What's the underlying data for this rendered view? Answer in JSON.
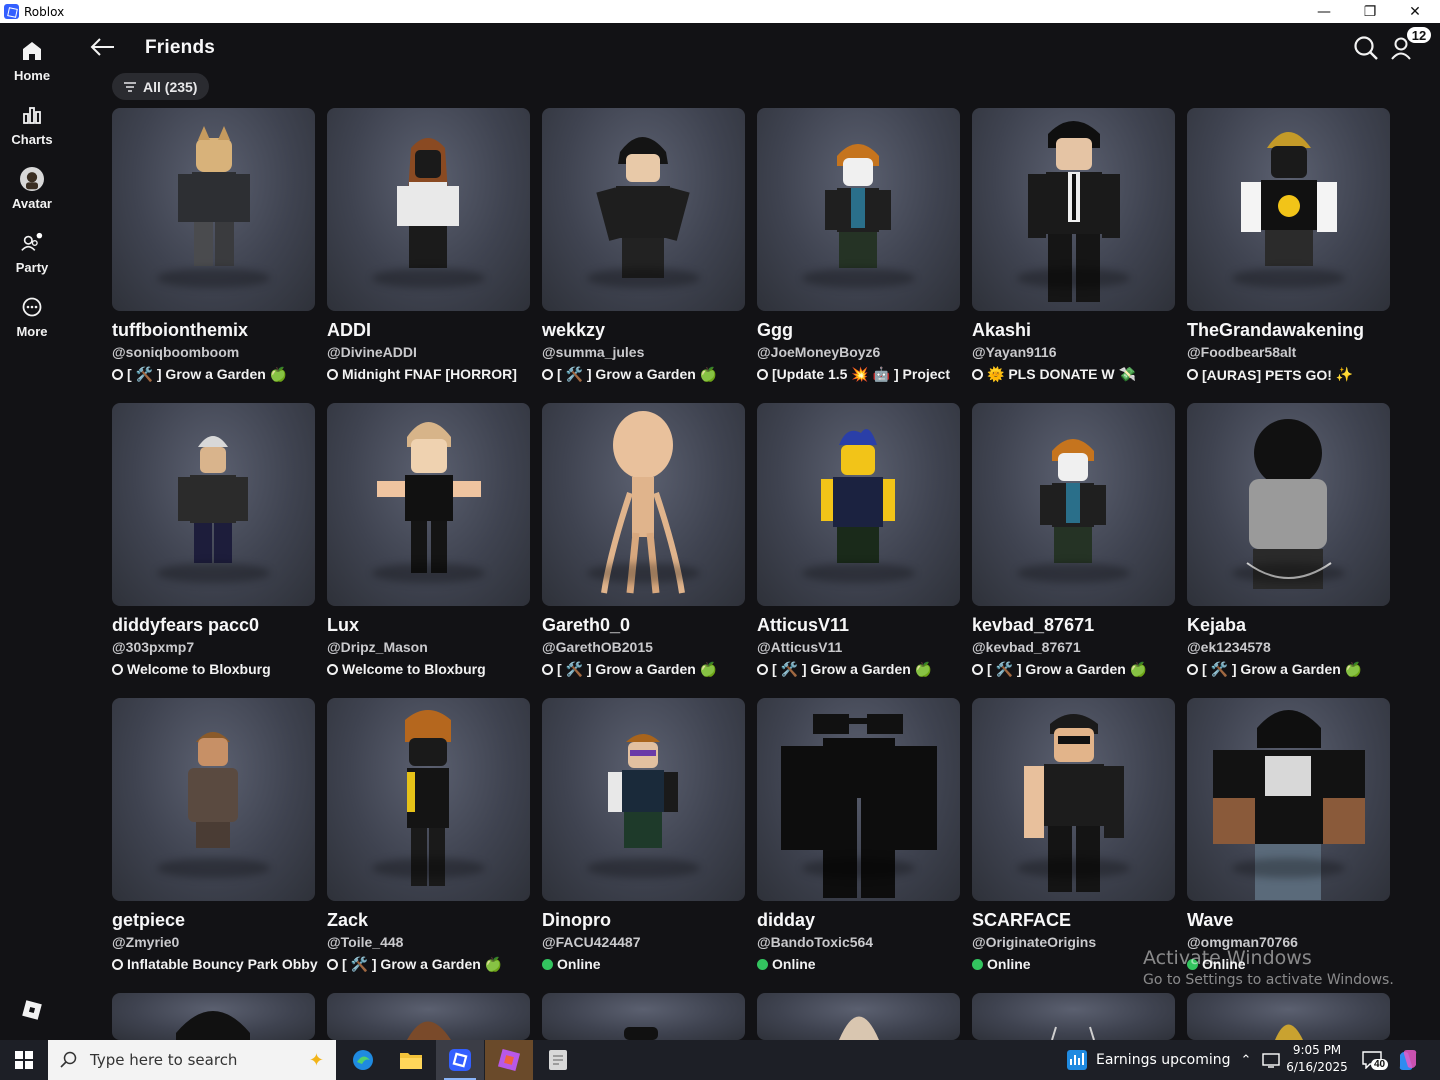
{
  "window": {
    "title": "Roblox",
    "minimize_glyph": "—",
    "restore_glyph": "❐",
    "close_glyph": "✕"
  },
  "sidebar": {
    "items": [
      {
        "label": "Home",
        "icon": "home-icon"
      },
      {
        "label": "Charts",
        "icon": "charts-icon"
      },
      {
        "label": "Avatar",
        "icon": "avatar-icon"
      },
      {
        "label": "Party",
        "icon": "party-icon"
      },
      {
        "label": "More",
        "icon": "more-icon"
      }
    ]
  },
  "header": {
    "title": "Friends",
    "notification_count": "12"
  },
  "filter": {
    "label": "All (235)"
  },
  "colors": {
    "background": "#121215",
    "online": "#33c45f",
    "brand": "#335fff"
  },
  "friends": [
    {
      "name": "tuffboionthemix",
      "username": "@soniqboomboom",
      "status": "[ 🛠️ ] Grow a Garden",
      "emoji": "🍏",
      "online": false
    },
    {
      "name": "ADDI",
      "username": "@DivineADDI",
      "status": "Midnight FNAF [HORROR]",
      "emoji": "",
      "online": false
    },
    {
      "name": "wekkzy",
      "username": "@summa_jules",
      "status": "[ 🛠️ ] Grow a Garden",
      "emoji": "🍏",
      "online": false
    },
    {
      "name": "Ggg",
      "username": "@JoeMoneyBoyz6",
      "status": "[Update 1.5 💥 🤖 ] Project",
      "emoji": "",
      "online": false
    },
    {
      "name": "Akashi",
      "username": "@Yayan9116",
      "status": "🌞 PLS DONATE W 💸",
      "emoji": "",
      "online": false
    },
    {
      "name": "TheGrandawakening",
      "username": "@Foodbear58alt",
      "status": "[AURAS] PETS GO!",
      "emoji": "✨",
      "online": false
    },
    {
      "name": "diddyfears pacc0",
      "username": "@303pxmp7",
      "status": "Welcome to Bloxburg",
      "emoji": "",
      "online": false
    },
    {
      "name": "Lux",
      "username": "@Dripz_Mason",
      "status": "Welcome to Bloxburg",
      "emoji": "",
      "online": false
    },
    {
      "name": "Gareth0_0",
      "username": "@GarethOB2015",
      "status": "[ 🛠️ ] Grow a Garden",
      "emoji": "🍏",
      "online": false
    },
    {
      "name": "AtticusV11",
      "username": "@AtticusV11",
      "status": "[ 🛠️ ] Grow a Garden",
      "emoji": "🍏",
      "online": false
    },
    {
      "name": "kevbad_87671",
      "username": "@kevbad_87671",
      "status": "[ 🛠️ ] Grow a Garden",
      "emoji": "🍏",
      "online": false
    },
    {
      "name": "Kejaba",
      "username": "@ek1234578",
      "status": "[ 🛠️ ] Grow a Garden",
      "emoji": "🍏",
      "online": false
    },
    {
      "name": "getpiece",
      "username": "@Zmyrie0",
      "status": "Inflatable Bouncy Park Obby",
      "emoji": "",
      "online": false
    },
    {
      "name": "Zack",
      "username": "@Toile_448",
      "status": "[ 🛠️ ] Grow a Garden",
      "emoji": "🍏",
      "online": false
    },
    {
      "name": "Dinopro",
      "username": "@FACU424487",
      "status": "Online",
      "emoji": "",
      "online": true
    },
    {
      "name": "didday",
      "username": "@BandoToxic564",
      "status": "Online",
      "emoji": "",
      "online": true
    },
    {
      "name": "SCARFACE",
      "username": "@OriginateOrigins",
      "status": "Online",
      "emoji": "",
      "online": true
    },
    {
      "name": "Wave",
      "username": "@omgman70766",
      "status": "Online",
      "emoji": "",
      "online": true
    }
  ],
  "watermark": {
    "line1": "Activate Windows",
    "line2": "Go to Settings to activate Windows."
  },
  "taskbar": {
    "search_placeholder": "Type here to search",
    "weather_text": "Earnings upcoming",
    "time": "9:05 PM",
    "date": "6/16/2025",
    "notification_count": "40"
  }
}
